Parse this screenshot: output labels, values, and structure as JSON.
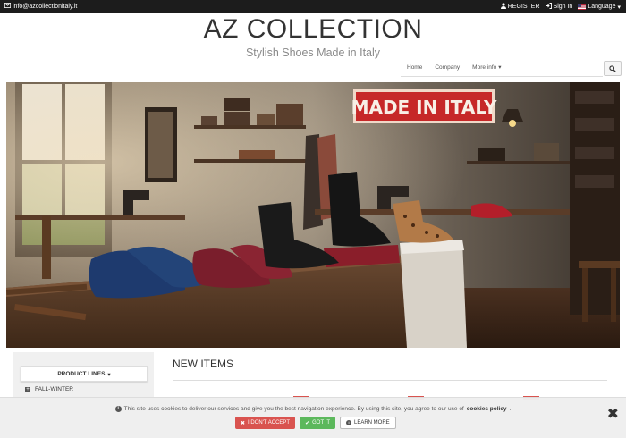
{
  "topbar": {
    "email": "info@azcollectionitaly.it",
    "register": "REGISTER",
    "sign_in": "Sign In",
    "language": "Language"
  },
  "brand": {
    "title": "AZ COLLECTION",
    "tagline": "Stylish Shoes Made in Italy"
  },
  "nav": {
    "home": "Home",
    "company": "Company",
    "more_info": "More info"
  },
  "hero": {
    "sign_text": "MADE IN ITALY"
  },
  "sidebar": {
    "product_lines": "PRODUCT LINES",
    "items": [
      "FALL-WINTER"
    ]
  },
  "main": {
    "section_title": "NEW ITEMS"
  },
  "cookie": {
    "message": "This site uses cookies to deliver our services and give you the best navigation experience. By using this site, you agree to our use of",
    "policy_link": "cookies policy",
    "deny": "I DON'T ACCEPT",
    "accept": "GOT IT",
    "learn_more": "LEARN MORE"
  },
  "colors": {
    "topbar_bg": "#1c1c1c",
    "deny": "#d9534f",
    "accept": "#5cb85c",
    "sign_red": "#c62828"
  }
}
